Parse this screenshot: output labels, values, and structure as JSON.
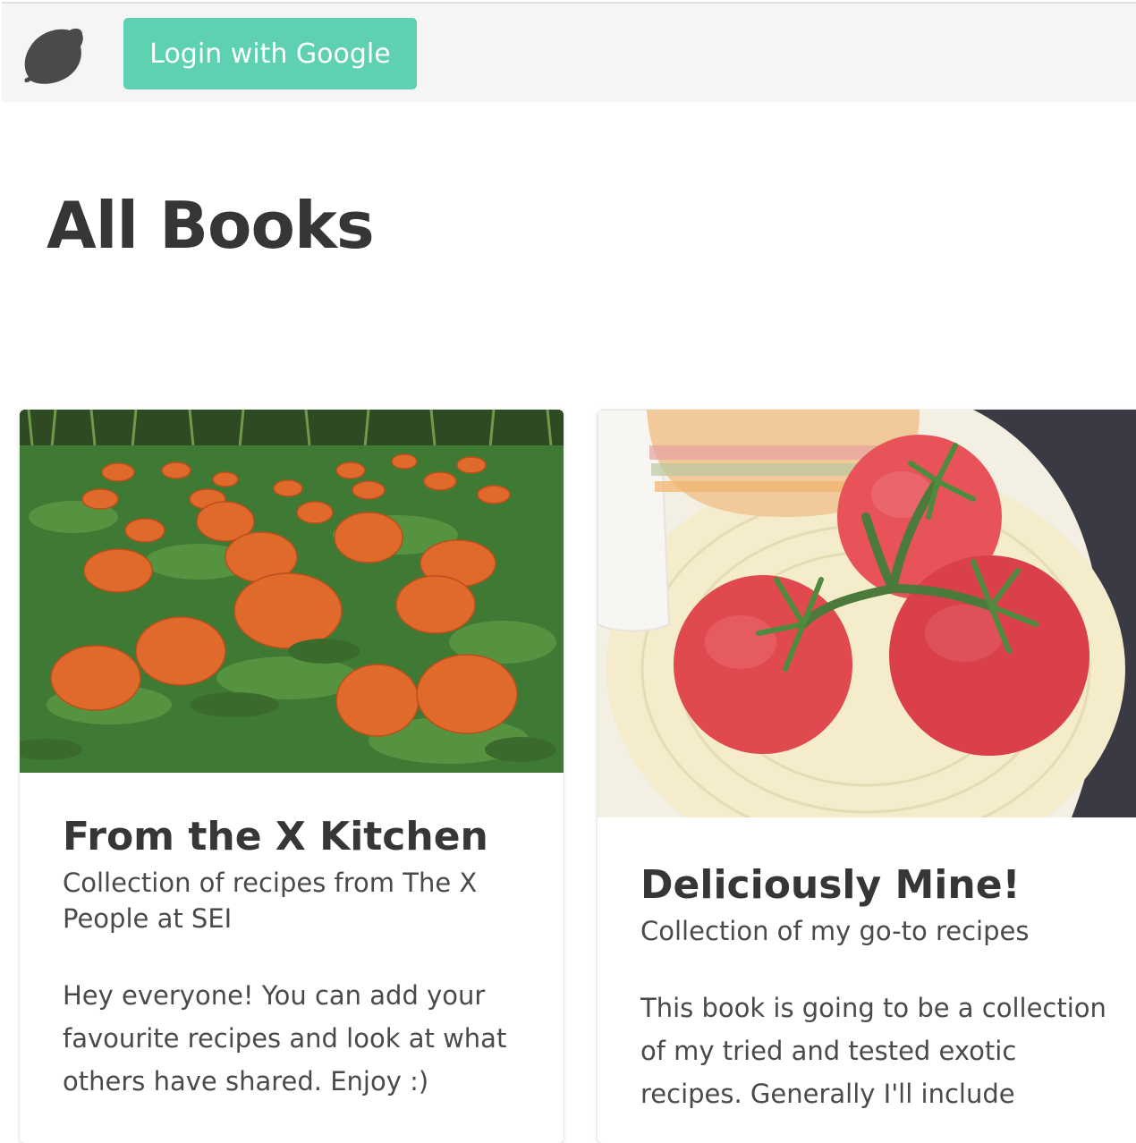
{
  "header": {
    "logo_icon": "lemon-icon",
    "login_label": "Login with Google",
    "accent_color": "#5ed1b2"
  },
  "main": {
    "title": "All Books",
    "books": [
      {
        "image": "pumpkin-field-photo",
        "title": "From the X Kitchen",
        "subtitle": "Collection of recipes from The X People at SEI",
        "description": "Hey everyone! You can add your favourite recipes and look at what others have shared. Enjoy :)"
      },
      {
        "image": "tomatoes-photo",
        "title": "Deliciously Mine!",
        "subtitle": "Collection of my go-to recipes",
        "description": "This book is going to be a collection of my tried and tested exotic recipes. Generally I'll include"
      }
    ]
  }
}
